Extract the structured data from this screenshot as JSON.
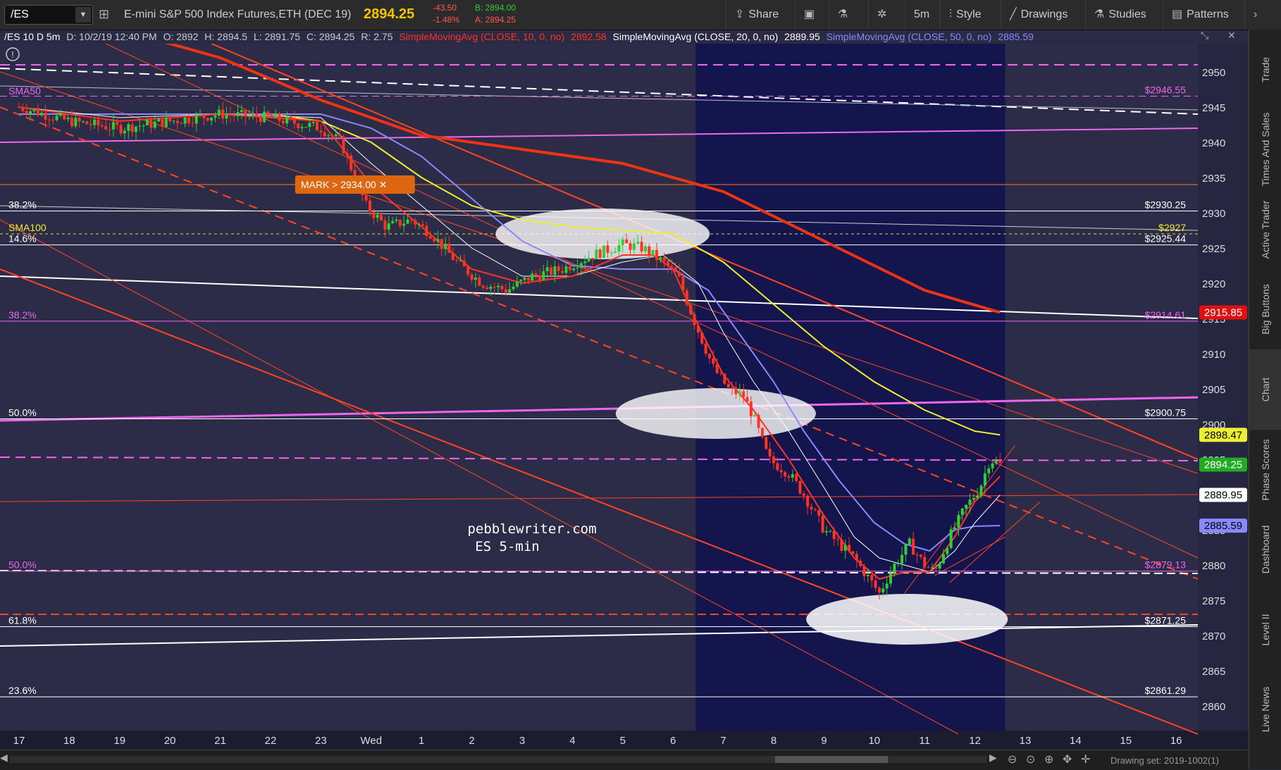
{
  "toolbar": {
    "symbol": "/ES",
    "instrument": "E-mini S&P 500 Index Futures,ETH (DEC 19)",
    "last": "2894.25",
    "change": "-43.50",
    "change_pct": "-1.48%",
    "bid": "B: 2894.00",
    "ask": "A: 2894.25",
    "share": "Share",
    "aggregation": "5m",
    "style": "Style",
    "drawings": "Drawings",
    "studies": "Studies",
    "patterns": "Patterns"
  },
  "infobar": {
    "descriptor": "/ES 10 D 5m",
    "date": "D: 10/2/19 12:40 PM",
    "open": "O: 2892",
    "high": "H: 2894.5",
    "low": "L: 2891.75",
    "close": "C: 2894.25",
    "range": "R: 2.75",
    "sma10": "SimpleMovingAvg (CLOSE, 10, 0, no)",
    "sma10_val": "2892.58",
    "sma20": "SimpleMovingAvg (CLOSE, 20, 0, no)",
    "sma20_val": "2889.95",
    "sma50": "SimpleMovingAvg (CLOSE, 50, 0, no)",
    "sma50_val": "2885.59"
  },
  "side_tabs": [
    "Trade",
    "Times And Sales",
    "Active Trader",
    "Big Buttons",
    "Chart",
    "Phase Scores",
    "Dashboard",
    "Level II",
    "Live News"
  ],
  "footer": {
    "drawing_set": "Drawing set: 2019-1002(1)"
  },
  "colors": {
    "background": "#2a2a44",
    "session_highlight": "#14144c",
    "price_axis": "#2a2a44",
    "up": "#33cc33",
    "down": "#ff3322"
  },
  "chart_data": {
    "type": "candlestick",
    "ylim": [
      2856,
      2954
    ],
    "yticks": [
      2950,
      2945,
      2940,
      2935,
      2930,
      2925,
      2920,
      2915,
      2910,
      2905,
      2900,
      2895,
      2890,
      2885,
      2880,
      2875,
      2870,
      2865,
      2860
    ],
    "x_labels": [
      "17",
      "18",
      "19",
      "20",
      "21",
      "22",
      "23",
      "Wed",
      "1",
      "2",
      "3",
      "4",
      "5",
      "6",
      "7",
      "8",
      "9",
      "10",
      "11",
      "12",
      "13",
      "14",
      "15",
      "16"
    ],
    "watermark": [
      "pebblewriter.com",
      "ES 5-min"
    ],
    "mark_label": "MARK > 2934.00 ✕",
    "mark_price": 2934,
    "price_tags": [
      {
        "value": "2915.85",
        "price": 2915.85,
        "color": "#dd1111",
        "fg": "#ffffff"
      },
      {
        "value": "2898.47",
        "price": 2898.47,
        "color": "#eeee33",
        "fg": "#000000"
      },
      {
        "value": "2894.25",
        "price": 2894.25,
        "color": "#22aa22",
        "fg": "#ffffff"
      },
      {
        "value": "2889.95",
        "price": 2889.95,
        "color": "#ffffff",
        "fg": "#000000"
      },
      {
        "value": "2885.59",
        "price": 2885.59,
        "color": "#8888ff",
        "fg": "#000000"
      }
    ],
    "levels": [
      {
        "price": 2946.55,
        "right_label": "$2946.55",
        "color": "#ee66ee",
        "style": "dash"
      },
      {
        "price": 2930.25,
        "left_label": "38.2%",
        "right_label": "$2930.25",
        "color": "#ffffff",
        "style": "solid"
      },
      {
        "price": 2927,
        "left_label": "SMA100",
        "right_label": "$2927",
        "color": "#dddd33",
        "style": "dot"
      },
      {
        "price": 2925.44,
        "left_label": "14.6%",
        "right_label": "$2925.44",
        "color": "#ffffff",
        "style": "solid"
      },
      {
        "price": 2914.61,
        "left_label": "38.2%",
        "right_label": "$2914.61",
        "color": "#ee66ee",
        "style": "solid"
      },
      {
        "price": 2900.75,
        "left_label": "50.0%",
        "right_label": "$2900.75",
        "color": "#ffffff",
        "style": "solid"
      },
      {
        "price": 2879.13,
        "left_label": "50.0%",
        "right_label": "$2879.13",
        "color": "#ee66ee",
        "style": "solid"
      },
      {
        "price": 2871.25,
        "left_label": "61.8%",
        "right_label": "$2871.25",
        "color": "#ffffff",
        "style": "solid"
      },
      {
        "price": 2861.29,
        "left_label": "23.6%",
        "right_label": "$2861.29",
        "color": "#ffffff",
        "style": "solid"
      }
    ],
    "sma50_label": "SMA50",
    "series": [
      {
        "name": "SimpleMovingAvg (CLOSE, 10, 0, no)",
        "color": "#ff3322"
      },
      {
        "name": "SimpleMovingAvg (CLOSE, 20, 0, no)",
        "color": "#ffffff"
      },
      {
        "name": "SimpleMovingAvg (CLOSE, 50, 0, no)",
        "color": "#8888ff"
      }
    ],
    "price_path": [
      [
        0,
        2945
      ],
      [
        1,
        2943
      ],
      [
        2,
        2942
      ],
      [
        3,
        2943
      ],
      [
        4,
        2944
      ],
      [
        5,
        2943.5
      ],
      [
        6,
        2942
      ],
      [
        6.4,
        2940
      ],
      [
        6.9,
        2931
      ],
      [
        7.3,
        2928
      ],
      [
        7.8,
        2929
      ],
      [
        8.2,
        2927
      ],
      [
        8.7,
        2923
      ],
      [
        9.2,
        2920
      ],
      [
        9.7,
        2919
      ],
      [
        10.2,
        2921
      ],
      [
        10.8,
        2922
      ],
      [
        11.4,
        2924
      ],
      [
        12,
        2925.5
      ],
      [
        12.4,
        2925
      ],
      [
        12.8,
        2923
      ],
      [
        13.1,
        2921
      ],
      [
        13.4,
        2915
      ],
      [
        13.8,
        2908
      ],
      [
        14.1,
        2905
      ],
      [
        14.4,
        2904
      ],
      [
        14.6,
        2901
      ],
      [
        14.9,
        2895
      ],
      [
        15.3,
        2893
      ],
      [
        15.6,
        2890
      ],
      [
        16,
        2885
      ],
      [
        16.3,
        2883
      ],
      [
        16.6,
        2881
      ],
      [
        16.9,
        2878
      ],
      [
        17.1,
        2876
      ],
      [
        17.4,
        2880
      ],
      [
        17.7,
        2883
      ],
      [
        18,
        2880
      ],
      [
        18.2,
        2879
      ],
      [
        18.5,
        2884
      ],
      [
        18.8,
        2888
      ],
      [
        19.1,
        2891
      ],
      [
        19.3,
        2895
      ],
      [
        19.5,
        2894.25
      ]
    ],
    "sma10_path": [
      [
        0,
        2945
      ],
      [
        2,
        2943
      ],
      [
        4,
        2944
      ],
      [
        6,
        2943
      ],
      [
        7,
        2934
      ],
      [
        8,
        2928
      ],
      [
        9,
        2922
      ],
      [
        10,
        2920
      ],
      [
        11,
        2921
      ],
      [
        12,
        2924
      ],
      [
        12.6,
        2924
      ],
      [
        13,
        2922
      ],
      [
        13.5,
        2914
      ],
      [
        14,
        2907
      ],
      [
        14.6,
        2902
      ],
      [
        15.3,
        2895
      ],
      [
        16,
        2887
      ],
      [
        16.6,
        2881
      ],
      [
        17.1,
        2878
      ],
      [
        17.6,
        2879
      ],
      [
        18.1,
        2879
      ],
      [
        18.6,
        2884
      ],
      [
        19,
        2889
      ],
      [
        19.5,
        2892.58
      ]
    ],
    "sma20_path": [
      [
        0,
        2945
      ],
      [
        2,
        2943.5
      ],
      [
        4,
        2944
      ],
      [
        6,
        2943.5
      ],
      [
        7,
        2937
      ],
      [
        8,
        2931
      ],
      [
        9,
        2925
      ],
      [
        10,
        2921
      ],
      [
        11,
        2921
      ],
      [
        12,
        2923
      ],
      [
        12.8,
        2924
      ],
      [
        13.5,
        2920
      ],
      [
        14,
        2913
      ],
      [
        14.6,
        2906
      ],
      [
        15.3,
        2899
      ],
      [
        16,
        2891
      ],
      [
        16.6,
        2884
      ],
      [
        17.1,
        2881
      ],
      [
        17.6,
        2880
      ],
      [
        18.1,
        2879
      ],
      [
        18.6,
        2882
      ],
      [
        19,
        2886
      ],
      [
        19.5,
        2889.95
      ]
    ],
    "sma50_path": [
      [
        0,
        2944
      ],
      [
        3,
        2944
      ],
      [
        5,
        2944
      ],
      [
        6,
        2944
      ],
      [
        7,
        2942
      ],
      [
        8,
        2938
      ],
      [
        9,
        2932
      ],
      [
        10,
        2926
      ],
      [
        11,
        2922.5
      ],
      [
        12,
        2922
      ],
      [
        13,
        2922
      ],
      [
        13.7,
        2919
      ],
      [
        14.3,
        2913
      ],
      [
        15,
        2906
      ],
      [
        15.6,
        2899
      ],
      [
        16.3,
        2892
      ],
      [
        17,
        2886
      ],
      [
        17.6,
        2883
      ],
      [
        18.1,
        2882
      ],
      [
        18.6,
        2885
      ],
      [
        19,
        2885.5
      ],
      [
        19.5,
        2885.59
      ]
    ],
    "sma100_path": [
      [
        0,
        2944
      ],
      [
        3,
        2944
      ],
      [
        5,
        2944
      ],
      [
        6,
        2943
      ],
      [
        7,
        2940
      ],
      [
        8,
        2935
      ],
      [
        9,
        2931
      ],
      [
        10,
        2929
      ],
      [
        11,
        2928
      ],
      [
        12,
        2927.5
      ],
      [
        13,
        2927
      ],
      [
        14,
        2923
      ],
      [
        15,
        2917
      ],
      [
        16,
        2911
      ],
      [
        17,
        2906
      ],
      [
        18,
        2902
      ],
      [
        19,
        2899
      ],
      [
        19.5,
        2898.47
      ]
    ],
    "sma200_path": [
      [
        0,
        2960
      ],
      [
        4,
        2952
      ],
      [
        6,
        2946
      ],
      [
        8,
        2941
      ],
      [
        10,
        2939
      ],
      [
        12,
        2937
      ],
      [
        14,
        2933
      ],
      [
        16,
        2926
      ],
      [
        18,
        2919
      ],
      [
        19.5,
        2915.85
      ]
    ]
  }
}
